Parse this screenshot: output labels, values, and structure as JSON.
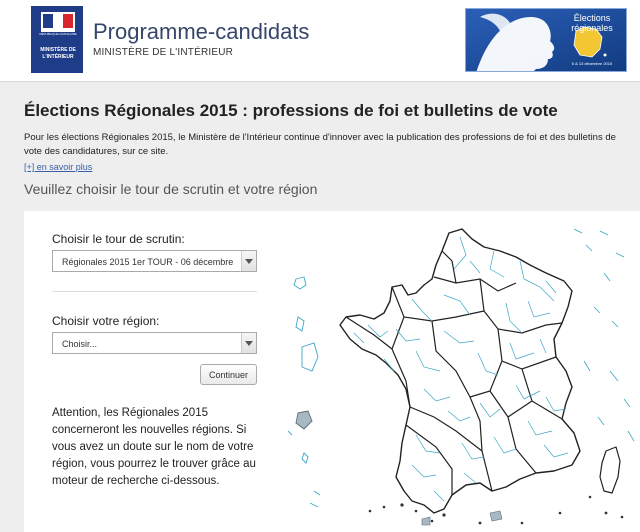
{
  "header": {
    "logo": {
      "caption": "RÉPUBLIQUE FRANÇAISE",
      "ministry": "MINISTÈRE DE L'INTÉRIEUR"
    },
    "title": "Programme-candidats",
    "subtitle": "MINISTÈRE DE L'INTÉRIEUR",
    "banner": {
      "title": "Élections régionales",
      "date": "6 & 13 décembre 2015"
    }
  },
  "main": {
    "title": "Élections Régionales 2015 : professions de foi et bulletins de vote",
    "intro": "Pour les élections Régionales 2015, le Ministère de l'Intérieur continue d'innover avec la publication des professions de foi et des bulletins de vote des candidatures, sur ce site.",
    "more_link": "[+] en savoir plus",
    "prompt": "Veuillez choisir le tour de scrutin et votre région"
  },
  "form": {
    "round_label": "Choisir le tour de scrutin:",
    "round_value": "Régionales 2015 1er TOUR - 06 décembre",
    "region_label": "Choisir votre région:",
    "region_value": "Choisir...",
    "continue_label": "Continuer",
    "notice": "Attention, les Régionales 2015 concerneront les nouvelles régions. Si vous avez un doute sur le nom de votre région, vous pourrez le trouver grâce au moteur de recherche ci-dessous."
  },
  "colors": {
    "accent": "#36466a",
    "link": "#3a5ea8",
    "map_department_border": "#3aa7c8",
    "map_region_border": "#222222",
    "panel_bg": "#ffffff",
    "page_bg": "#eeeeee"
  }
}
